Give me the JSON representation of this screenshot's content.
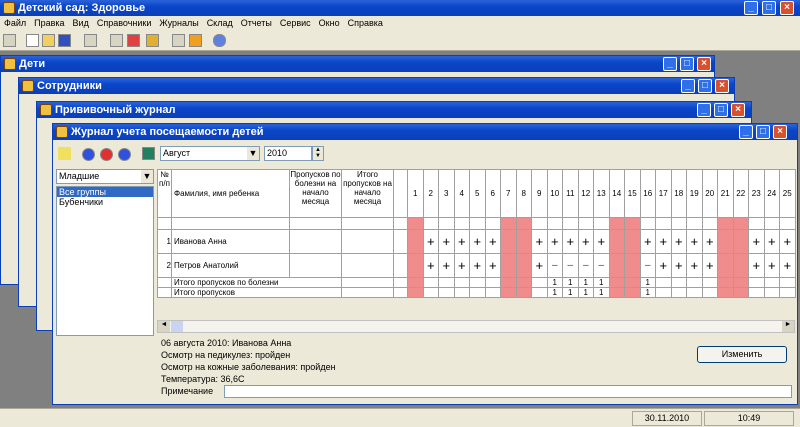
{
  "app": {
    "title": "Детский сад: Здоровье"
  },
  "menu": [
    "Файл",
    "Правка",
    "Вид",
    "Справочники",
    "Журналы",
    "Склад",
    "Отчеты",
    "Сервис",
    "Окно",
    "Справка"
  ],
  "windows": {
    "w1": "Дети",
    "w2": "Сотрудники",
    "w3": "Прививочный журнал",
    "w4": "Журнал учета посещаемости детей"
  },
  "journal": {
    "month": "Август",
    "year": "2010",
    "group_select": "Младшие",
    "groups": [
      "Все группы",
      "Бубенчики"
    ],
    "headers": {
      "num": "№ п/п",
      "name": "Фамилия, имя ребенка",
      "absent_ill": "Пропусков по болезни на начало месяца",
      "absent_total": "Итого пропусков на начало месяца"
    },
    "days": [
      "1",
      "2",
      "3",
      "4",
      "5",
      "6",
      "7",
      "8",
      "9",
      "10",
      "11",
      "12",
      "13",
      "14",
      "15",
      "16",
      "17",
      "18",
      "19",
      "20",
      "21",
      "22",
      "23",
      "24",
      "25"
    ],
    "weekend_days": [
      1,
      7,
      8,
      14,
      15,
      21,
      22
    ],
    "rows": [
      {
        "num": "1",
        "name": "Иванова Анна",
        "marks": [
          "",
          "+",
          "+",
          "+",
          "+",
          "+",
          "",
          "",
          "+",
          "+",
          "+",
          "+",
          "+",
          "",
          "",
          "+",
          "+",
          "+",
          "+",
          "+",
          "",
          "",
          "+",
          "+",
          "+"
        ]
      },
      {
        "num": "2",
        "name": "Петров Анатолий",
        "marks": [
          "",
          "+",
          "+",
          "+",
          "+",
          "+",
          "",
          "",
          "+",
          "–",
          "–",
          "–",
          "–",
          "",
          "",
          "–",
          "+",
          "+",
          "+",
          "+",
          "",
          "",
          "+",
          "+",
          "+"
        ]
      }
    ],
    "totals": [
      {
        "label": "Итого пропусков по болезни",
        "marks": [
          "",
          "",
          "",
          "",
          "",
          "",
          "",
          "",
          "",
          "1",
          "1",
          "1",
          "1",
          "",
          "",
          "1",
          "",
          "",
          "",
          "",
          "",
          "",
          "",
          "",
          ""
        ]
      },
      {
        "label": "Итого пропусков",
        "marks": [
          "",
          "",
          "",
          "",
          "",
          "",
          "",
          "",
          "",
          "1",
          "1",
          "1",
          "1",
          "",
          "",
          "1",
          "",
          "",
          "",
          "",
          "",
          "",
          "",
          "",
          ""
        ]
      }
    ],
    "detail": {
      "date_child": "06 августа 2010:  Иванова Анна",
      "line1": "Осмотр на педикулез: пройден",
      "line2": "Осмотр на кожные заболевания: пройден",
      "line3": "Температура: 36,6С",
      "note_label": "Примечание",
      "edit_button": "Изменить"
    }
  },
  "status": {
    "date": "30.11.2010",
    "time": "10:49"
  }
}
